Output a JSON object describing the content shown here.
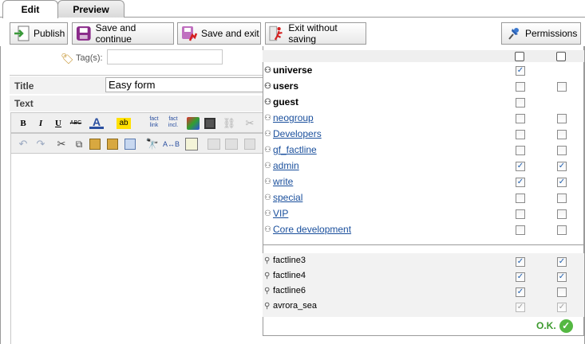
{
  "tabs": [
    {
      "label": "Edit",
      "active": true
    },
    {
      "label": "Preview",
      "active": false
    }
  ],
  "toolbar": {
    "publish": {
      "label": "Publish",
      "icon": "publish-icon"
    },
    "save_continue": {
      "label": "Save and continue",
      "icon": "save-icon"
    },
    "save_exit": {
      "label": "Save and exit",
      "icon": "save-exit-icon"
    },
    "exit_no_save": {
      "label": "Exit without saving",
      "icon": "exit-icon"
    },
    "permissions": {
      "label": "Permissions",
      "icon": "pin-icon"
    }
  },
  "form": {
    "tags_label": "Tag(s):",
    "tags_value": "",
    "title_label": "Title",
    "title_value": "Easy form",
    "text_label": "Text"
  },
  "editor": {
    "row1": [
      "B",
      "I",
      "U",
      "ABC",
      "A",
      "ab"
    ],
    "row1b": [
      "fact link",
      "fact incl."
    ]
  },
  "permissions": {
    "groups": [
      {
        "name": "universe",
        "bold": true,
        "link": false,
        "read": true,
        "write": null
      },
      {
        "name": "users",
        "bold": true,
        "link": false,
        "read": false,
        "write": false
      },
      {
        "name": "guest",
        "bold": true,
        "link": false,
        "read": false,
        "write": null
      },
      {
        "name": "neogroup",
        "bold": false,
        "link": true,
        "read": false,
        "write": false
      },
      {
        "name": "Developers",
        "bold": false,
        "link": true,
        "read": false,
        "write": false
      },
      {
        "name": "gf_factline",
        "bold": false,
        "link": true,
        "read": false,
        "write": false
      },
      {
        "name": "admin",
        "bold": false,
        "link": true,
        "read": true,
        "write": true
      },
      {
        "name": "write",
        "bold": false,
        "link": true,
        "read": true,
        "write": true
      },
      {
        "name": "special",
        "bold": false,
        "link": true,
        "read": false,
        "write": false
      },
      {
        "name": "VIP",
        "bold": false,
        "link": true,
        "read": false,
        "write": false
      },
      {
        "name": "Core development",
        "bold": false,
        "link": true,
        "read": false,
        "write": false
      }
    ],
    "users": [
      {
        "name": "factline3",
        "read": true,
        "write": true,
        "disabled": false
      },
      {
        "name": "factline4",
        "read": true,
        "write": true,
        "disabled": false
      },
      {
        "name": "factline6",
        "read": true,
        "write": false,
        "disabled": false
      },
      {
        "name": "avrora_sea",
        "read": true,
        "write": true,
        "disabled": true
      }
    ],
    "ok_label": "O.K."
  },
  "colors": {
    "link": "#1a4f9c",
    "ok": "#3c9a2e",
    "border": "#9a9a9a"
  }
}
